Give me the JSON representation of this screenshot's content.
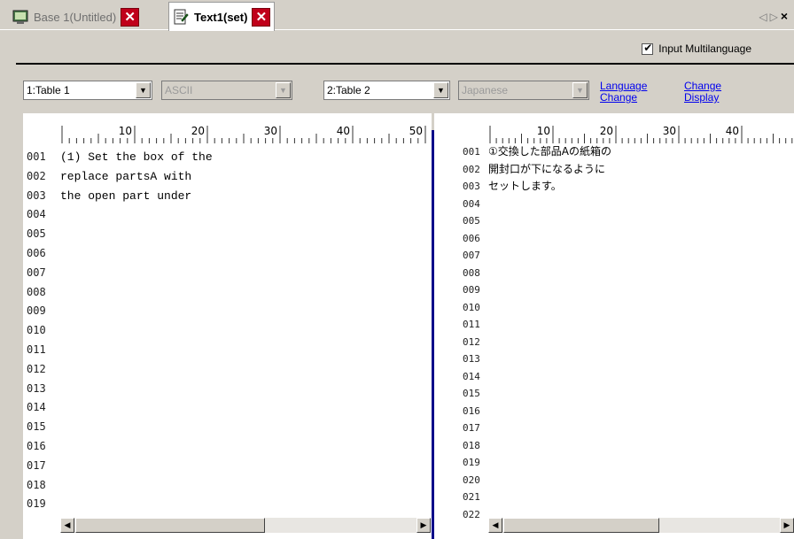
{
  "tabs": [
    {
      "label": "Base 1(Untitled)",
      "active": false
    },
    {
      "label": "Text1(set)",
      "active": true
    }
  ],
  "tab_nav": {
    "left": "◁",
    "right": "▷",
    "close": "×"
  },
  "options": {
    "input_multilanguage_label": "Input Multilanguage",
    "input_multilanguage_checked": true
  },
  "left": {
    "table_select": "1:Table 1",
    "charset_select": "ASCII",
    "ruler_ticks": [
      "10",
      "20",
      "30",
      "40",
      "50"
    ],
    "line_numbers": [
      "001",
      "002",
      "003",
      "004",
      "005",
      "006",
      "007",
      "008",
      "009",
      "010",
      "011",
      "012",
      "013",
      "014",
      "015",
      "016",
      "017",
      "018",
      "019"
    ],
    "lines": [
      "(1) Set the box of the",
      "replace partsA with",
      "the open part under"
    ]
  },
  "right": {
    "table_select": "2:Table 2",
    "language_select": "Japanese",
    "language_change_link": [
      "Language",
      "Change"
    ],
    "change_display_link": [
      "Change",
      "Display"
    ],
    "ruler_ticks": [
      "10",
      "20",
      "30",
      "40",
      "5"
    ],
    "line_numbers": [
      "001",
      "002",
      "003",
      "004",
      "005",
      "006",
      "007",
      "008",
      "009",
      "010",
      "011",
      "012",
      "013",
      "014",
      "015",
      "016",
      "017",
      "018",
      "019",
      "020",
      "021",
      "022"
    ],
    "lines": [
      "①交換した部品Aの紙箱の",
      "開封口が下になるように",
      "セットします。"
    ]
  },
  "colors": {
    "close_red": "#c0001a",
    "splitter_blue": "#0a0a8a",
    "link_blue": "#0000ee"
  }
}
